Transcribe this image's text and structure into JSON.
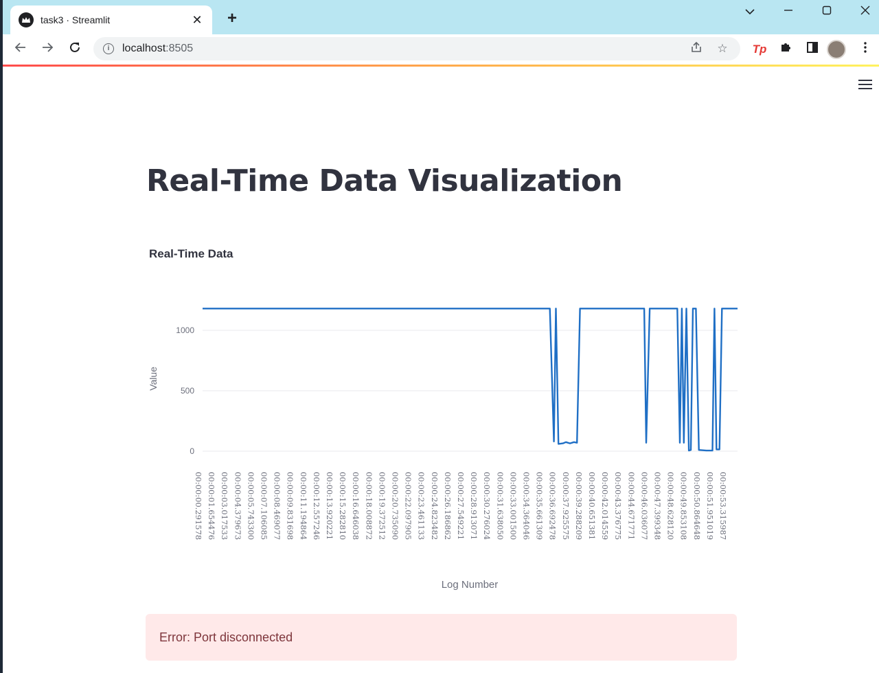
{
  "browser": {
    "tab_title": "task3 · Streamlit",
    "url_host": "localhost",
    "url_port": ":8505"
  },
  "page": {
    "title": "Real-Time Data Visualization",
    "error_message": "Error: Port disconnected"
  },
  "colors": {
    "line": "#1f6fc5",
    "error_bg": "#ffe9e9",
    "error_text": "#7d353b",
    "accent": "#ff4b4b"
  },
  "chart_data": {
    "type": "line",
    "title": "Real-Time Data",
    "xlabel": "Log Number",
    "ylabel": "Value",
    "ylim": [
      0,
      1200
    ],
    "y_ticks": [
      0,
      500,
      1000
    ],
    "grid": true,
    "x_tick_labels": [
      "00:00:00.291578",
      "00:00:01.654476",
      "00:00:03.017533",
      "00:00:04.379673",
      "00:00:05.743300",
      "00:00:07.106085",
      "00:00:08.469077",
      "00:00:09.831698",
      "00:00:11.194864",
      "00:00:12.557246",
      "00:00:13.920221",
      "00:00:15.282810",
      "00:00:16.646038",
      "00:00:18.008872",
      "00:00:19.372512",
      "00:00:20.735090",
      "00:00:22.097905",
      "00:00:23.461133",
      "00:00:24.823482",
      "00:00:26.186862",
      "00:00:27.549221",
      "00:00:28.913071",
      "00:00:30.276024",
      "00:00:31.638050",
      "00:00:33.001500",
      "00:00:34.364046",
      "00:00:35.661309",
      "00:00:36.692478",
      "00:00:37.925575",
      "00:00:39.288209",
      "00:00:40.651381",
      "00:00:42.014559",
      "00:00:43.376775",
      "00:00:44.671771",
      "00:00:46.036077",
      "00:00:47.399348",
      "00:00:48.628120",
      "00:00:49.853108",
      "00:00:50.864648",
      "00:00:51.951019",
      "00:00:53.315987"
    ],
    "series": [
      {
        "points": [
          [
            0.29,
            1180
          ],
          [
            34.9,
            1180
          ],
          [
            35.3,
            80
          ],
          [
            35.5,
            1180
          ],
          [
            35.75,
            60
          ],
          [
            36.2,
            65
          ],
          [
            36.5,
            75
          ],
          [
            36.9,
            65
          ],
          [
            37.3,
            75
          ],
          [
            37.6,
            70
          ],
          [
            37.9,
            1180
          ],
          [
            44.3,
            1180
          ],
          [
            44.5,
            70
          ],
          [
            44.85,
            1180
          ],
          [
            47.6,
            1180
          ],
          [
            47.85,
            70
          ],
          [
            48.05,
            1180
          ],
          [
            48.25,
            70
          ],
          [
            48.5,
            1180
          ],
          [
            48.75,
            5
          ],
          [
            48.95,
            10
          ],
          [
            49.15,
            1180
          ],
          [
            49.45,
            1180
          ],
          [
            49.75,
            10
          ],
          [
            50.5,
            5
          ],
          [
            51.1,
            5
          ],
          [
            51.3,
            1180
          ],
          [
            51.5,
            15
          ],
          [
            51.8,
            15
          ],
          [
            52.05,
            1180
          ],
          [
            53.6,
            1180
          ]
        ]
      }
    ]
  }
}
